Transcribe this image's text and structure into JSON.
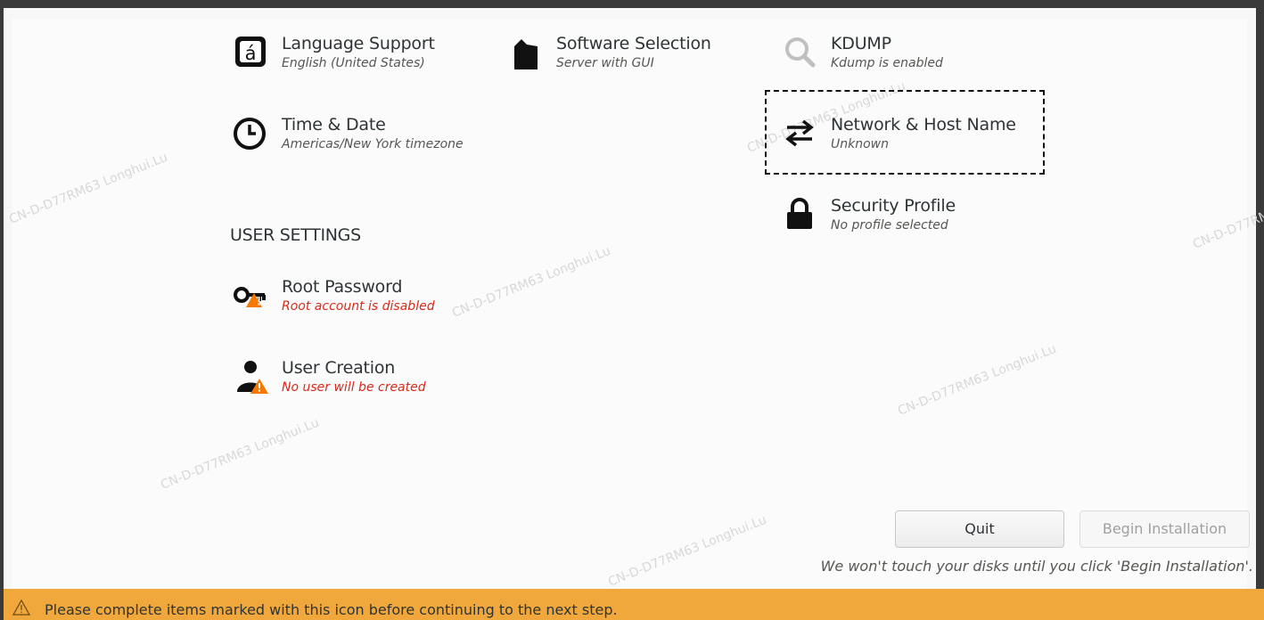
{
  "localization": {
    "language_support": {
      "title": "Language Support",
      "status": "English (United States)"
    },
    "time_date": {
      "title": "Time & Date",
      "status": "Americas/New York timezone"
    }
  },
  "software": {
    "software_selection": {
      "title": "Software Selection",
      "status": "Server with GUI"
    }
  },
  "system": {
    "kdump": {
      "title": "KDUMP",
      "status": "Kdump is enabled"
    },
    "network": {
      "title": "Network & Host Name",
      "status": "Unknown"
    },
    "security": {
      "title": "Security Profile",
      "status": "No profile selected"
    }
  },
  "user_settings": {
    "heading": "USER SETTINGS",
    "root_password": {
      "title": "Root Password",
      "status": "Root account is disabled"
    },
    "user_creation": {
      "title": "User Creation",
      "status": "No user will be created"
    }
  },
  "buttons": {
    "quit": "Quit",
    "begin": "Begin Installation"
  },
  "disk_note": "We won't touch your disks until you click 'Begin Installation'.",
  "warning_bar": {
    "text": "Please complete items marked with this icon before continuing to the next step."
  },
  "watermark": "CN-D-D77RM63 Longhui.Lu",
  "colors": {
    "warning": "#f0a83c",
    "status_error": "#d72b1c",
    "warn_icon": "#f57900"
  },
  "icons": {
    "language": "language-icon",
    "time": "clock-icon",
    "software": "package-icon",
    "kdump": "search-icon",
    "network": "network-arrows-icon",
    "security": "lock-icon",
    "root": "key-icon",
    "user": "user-icon",
    "warning": "warning-icon"
  }
}
